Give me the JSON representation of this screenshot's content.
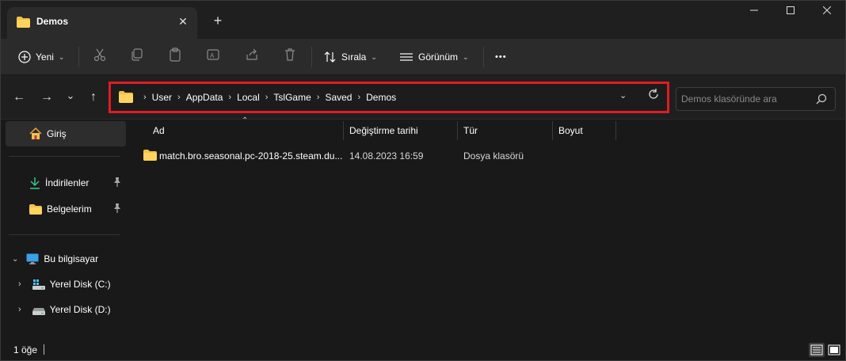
{
  "tab": {
    "title": "Demos",
    "close_glyph": "✕",
    "new_tab_glyph": "+"
  },
  "window_controls": {
    "minimize": "—",
    "maximize": "☐",
    "close": "✕"
  },
  "command_bar": {
    "new_label": "Yeni",
    "sort_label": "Sırala",
    "view_label": "Görünüm",
    "more_glyph": "•••",
    "icons": [
      "cut-icon",
      "copy-icon",
      "paste-icon",
      "rename-icon",
      "share-icon",
      "delete-icon"
    ]
  },
  "nav": {
    "back": "←",
    "forward": "→",
    "recent": "⌄",
    "up": "↑"
  },
  "address": {
    "crumbs": [
      "User",
      "AppData",
      "Local",
      "TslGame",
      "Saved",
      "Demos"
    ],
    "separator": "›",
    "highlight_color": "#e21b23"
  },
  "search": {
    "placeholder": "Demos klasöründe ara"
  },
  "sidebar": {
    "home": "Giriş",
    "downloads": "İndirilenler",
    "documents": "Belgelerim",
    "this_pc": "Bu bilgisayar",
    "disk_c": "Yerel Disk (C:)",
    "disk_d": "Yerel Disk (D:)"
  },
  "columns": {
    "name": "Ad",
    "modified": "Değiştirme tarihi",
    "type": "Tür",
    "size": "Boyut"
  },
  "files": [
    {
      "name": "match.bro.seasonal.pc-2018-25.steam.du...",
      "modified": "14.08.2023 16:59",
      "type": "Dosya klasörü",
      "size": ""
    }
  ],
  "status": {
    "count": "1 öğe"
  },
  "colors": {
    "folder": "#f2c14e",
    "accent": "#4cc2ff"
  }
}
